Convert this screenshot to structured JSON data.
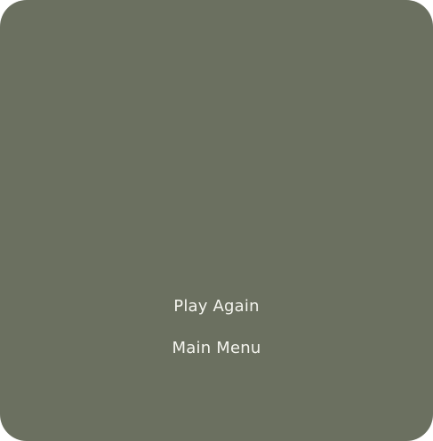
{
  "menu": {
    "play_again_label": "Play Again",
    "main_menu_label": "Main Menu"
  },
  "colors": {
    "panel_background": "#6b7060",
    "option_text": "#f4f4ee"
  }
}
